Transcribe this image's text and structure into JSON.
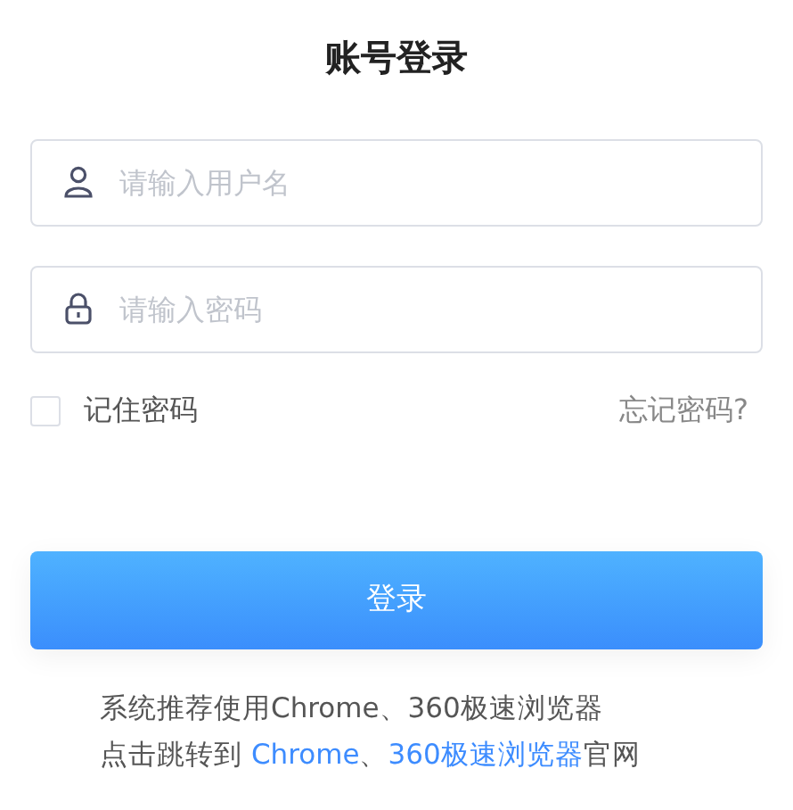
{
  "title": "账号登录",
  "fields": [
    {
      "kind": "user",
      "placeholder": "请输入用户名"
    },
    {
      "kind": "password",
      "placeholder": "请输入密码"
    }
  ],
  "remember": {
    "label": "记住密码",
    "checked": false
  },
  "forgot": "忘记密码?",
  "login_button": "登录",
  "notice": {
    "line1": "系统推荐使用Chrome、360极速浏览器",
    "prefix": "点击跳转到 ",
    "link1": "Chrome",
    "separator": "、",
    "link2": "360极速浏览器",
    "suffix": "官网"
  }
}
